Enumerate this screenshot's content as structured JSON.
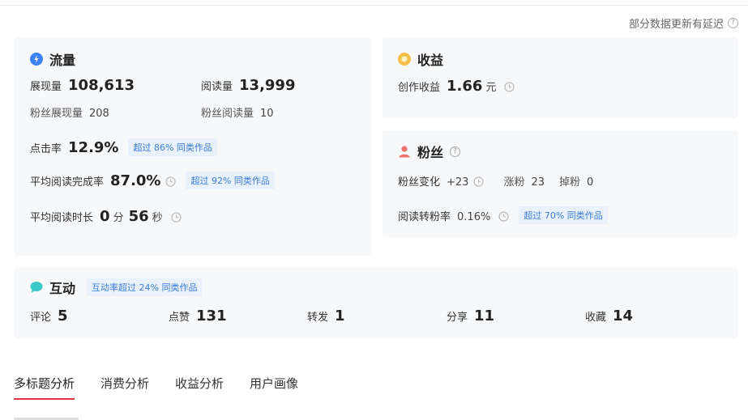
{
  "notice": "部分数据更新有延迟",
  "traffic": {
    "title": "流量",
    "impressions_label": "展现量",
    "impressions_value": "108,613",
    "reads_label": "阅读量",
    "reads_value": "13,999",
    "fan_impressions_label": "粉丝展现量",
    "fan_impressions_value": "208",
    "fan_reads_label": "粉丝阅读量",
    "fan_reads_value": "10",
    "ctr_label": "点击率",
    "ctr_value": "12.9%",
    "ctr_badge": "超过 86% 同类作品",
    "completion_label": "平均阅读完成率",
    "completion_value": "87.0%",
    "completion_badge": "超过 92% 同类作品",
    "duration_label": "平均阅读时长",
    "duration_min": "0",
    "duration_min_unit": "分",
    "duration_sec": "56",
    "duration_sec_unit": "秒"
  },
  "income": {
    "title": "收益",
    "creation_label": "创作收益",
    "creation_value": "1.66",
    "creation_unit": "元"
  },
  "fans": {
    "title": "粉丝",
    "change_label": "粉丝变化",
    "change_value": "+23",
    "gain_label": "涨粉",
    "gain_value": "23",
    "loss_label": "掉粉",
    "loss_value": "0",
    "conversion_label": "阅读转粉率",
    "conversion_value": "0.16%",
    "conversion_badge": "超过 70% 同类作品"
  },
  "interaction": {
    "title": "互动",
    "badge": "互动率超过 24% 同类作品",
    "items": [
      {
        "label": "评论",
        "value": "5"
      },
      {
        "label": "点赞",
        "value": "131"
      },
      {
        "label": "转发",
        "value": "1"
      },
      {
        "label": "分享",
        "value": "11"
      },
      {
        "label": "收藏",
        "value": "14"
      }
    ]
  },
  "tabs": [
    {
      "label": "多标题分析",
      "active": true
    },
    {
      "label": "消费分析",
      "active": false
    },
    {
      "label": "收益分析",
      "active": false
    },
    {
      "label": "用户画像",
      "active": false
    }
  ],
  "colors": {
    "traffic_icon": "#3b82f6",
    "income_icon": "#f5c04a",
    "fans_icon": "#f07070",
    "interaction_icon": "#3ec9c9",
    "tab_underline": "#e2333f",
    "badge_text": "#3a7bd5"
  }
}
